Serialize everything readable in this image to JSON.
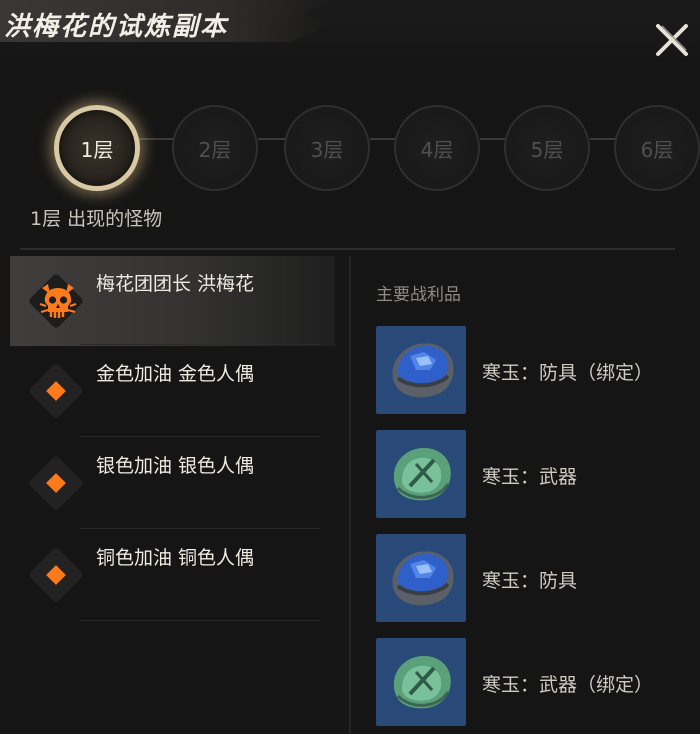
{
  "title": "洪梅花的试炼副本",
  "floors": [
    {
      "label": "1层",
      "active": true
    },
    {
      "label": "2层",
      "active": false
    },
    {
      "label": "3层",
      "active": false
    },
    {
      "label": "4层",
      "active": false
    },
    {
      "label": "5层",
      "active": false
    },
    {
      "label": "6层",
      "active": false
    }
  ],
  "monsters_heading": "1层 出现的怪物",
  "monsters": [
    {
      "name": "梅花团团长 洪梅花",
      "icon": "boss-skull-icon",
      "selected": true
    },
    {
      "name": "金色加油 金色人偶",
      "icon": "orange-diamond-icon",
      "selected": false
    },
    {
      "name": "银色加油 银色人偶",
      "icon": "orange-diamond-icon",
      "selected": false
    },
    {
      "name": "铜色加油 铜色人偶",
      "icon": "orange-diamond-icon",
      "selected": false
    }
  ],
  "loot_heading": "主要战利品",
  "loot": [
    {
      "label": "寒玉：防具（绑定）",
      "icon": "blue-jade-icon"
    },
    {
      "label": "寒玉：武器",
      "icon": "green-jade-icon"
    },
    {
      "label": "寒玉：防具",
      "icon": "blue-jade-icon"
    },
    {
      "label": "寒玉：武器（绑定）",
      "icon": "green-jade-icon"
    }
  ],
  "colors": {
    "accent": "#ff7a1a",
    "active_ring": "#d8c8a4",
    "loot_bg": "#294a78",
    "blue_gem": "#2f5fc8",
    "green_gem": "#5aa07a"
  }
}
